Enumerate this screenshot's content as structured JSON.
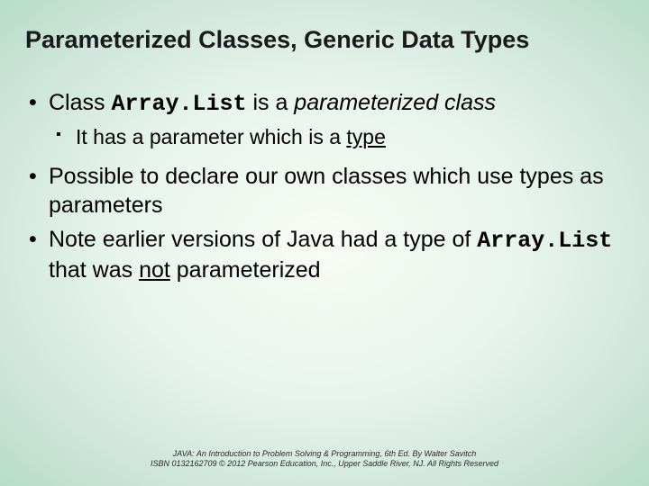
{
  "slide": {
    "title": "Parameterized Classes, Generic Data Types",
    "b1_pre": "Class ",
    "b1_code": "Array.List",
    "b1_mid": " is a ",
    "b1_ital": "parameterized class",
    "b1s1_pre": "It has a parameter which is a ",
    "b1s1_u": "type",
    "b2": "Possible to declare our own classes which use types as parameters",
    "b3_pre": "Note earlier versions of Java had a type of ",
    "b3_code": "Array.List",
    "b3_mid": " that was ",
    "b3_u": "not",
    "b3_post": " parameterized",
    "footer1": "JAVA: An Introduction to Problem Solving & Programming, 6th Ed. By Walter Savitch",
    "footer2": "ISBN 0132162709 © 2012 Pearson Education, Inc., Upper Saddle River, NJ. All Rights Reserved"
  }
}
